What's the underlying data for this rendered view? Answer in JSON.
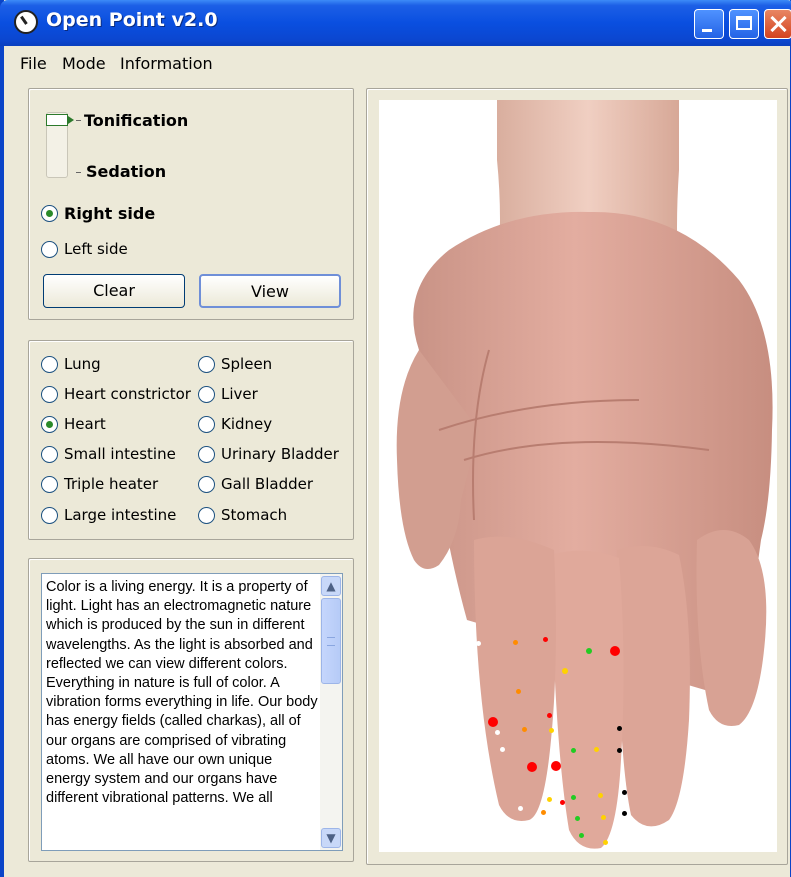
{
  "window": {
    "title": "Open Point v2.0"
  },
  "menu": [
    "File",
    "Mode",
    "Information"
  ],
  "mode": {
    "tonification_label": "Tonification",
    "sedation_label": "Sedation",
    "selected": "Tonification"
  },
  "side": {
    "options": [
      "Right side",
      "Left side"
    ],
    "selected": "Right side"
  },
  "buttons": {
    "clear": "Clear",
    "view": "View"
  },
  "meridians": {
    "left": [
      "Lung",
      "Heart constrictor",
      "Heart",
      "Small intestine",
      "Triple heater",
      "Large intestine"
    ],
    "right": [
      "Spleen",
      "Liver",
      "Kidney",
      "Urinary Bladder",
      "Gall Bladder",
      "Stomach"
    ],
    "selected": "Heart"
  },
  "info_text": "Color is a living energy. It is a property of light. Light has an electromagnetic nature which is produced by the sun in different wavelengths. As the light is absorbed and reflected we can view different colors. Everything in nature is full of color. A vibration forms everything in life. Our body has energy fields (called charkas), all of our organs are comprised of vibrating atoms. We all have our own unique energy system and our organs have different vibrational patterns. We all",
  "colors": {
    "titlebar": "#0a4fe0",
    "window_bg": "#ece9d8",
    "point_red": "#ff0000",
    "point_green": "#22cc22",
    "point_yellow": "#ffd200",
    "point_orange": "#ff8c00",
    "point_white": "#ffffff",
    "point_black": "#000000"
  }
}
